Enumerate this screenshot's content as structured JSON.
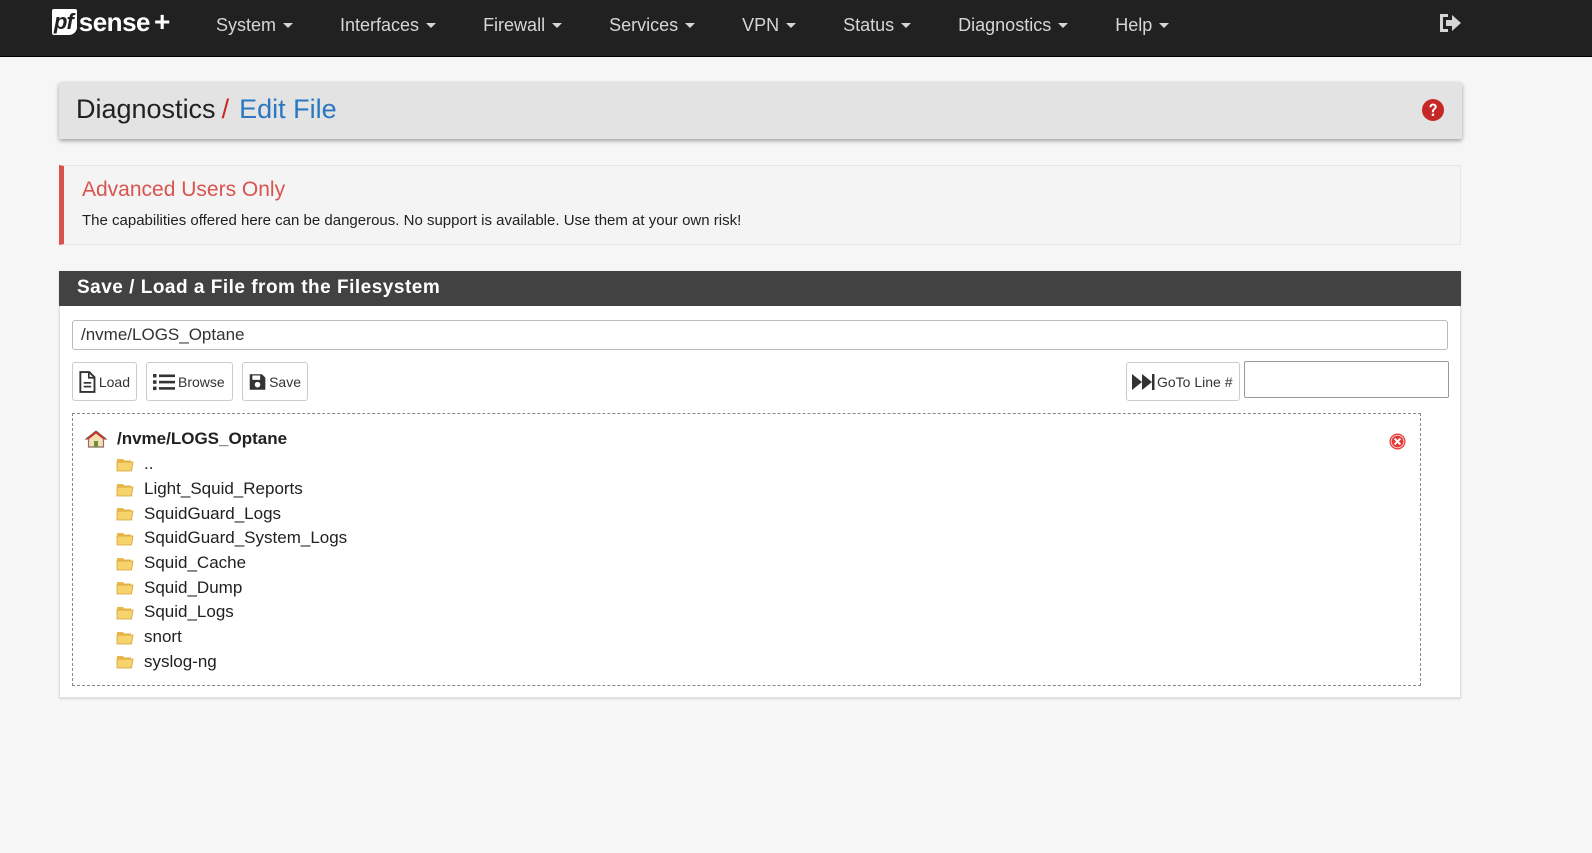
{
  "brand": {
    "pf": "pf",
    "sense": "sense",
    "plus": "+"
  },
  "nav": {
    "items": [
      {
        "label": "System",
        "name": "nav-system"
      },
      {
        "label": "Interfaces",
        "name": "nav-interfaces"
      },
      {
        "label": "Firewall",
        "name": "nav-firewall"
      },
      {
        "label": "Services",
        "name": "nav-services"
      },
      {
        "label": "VPN",
        "name": "nav-vpn"
      },
      {
        "label": "Status",
        "name": "nav-status"
      },
      {
        "label": "Diagnostics",
        "name": "nav-diagnostics"
      },
      {
        "label": "Help",
        "name": "nav-help"
      }
    ],
    "logout_icon": "sign-out-icon"
  },
  "header": {
    "breadcrumb_first": "Diagnostics",
    "separator": "/",
    "breadcrumb_current": "Edit File",
    "help_icon": "question-circle-icon"
  },
  "warning": {
    "title": "Advanced Users Only",
    "text": "The capabilities offered here can be dangerous. No support is available. Use them at your own risk!"
  },
  "panel": {
    "heading": "Save / Load a File from the Filesystem",
    "path_value": "/nvme/LOGS_Optane",
    "buttons": {
      "load": "Load",
      "browse": "Browse",
      "save": "Save",
      "goto": "GoTo Line #"
    },
    "goto_value": ""
  },
  "browser": {
    "current_path": "/nvme/LOGS_Optane",
    "items": [
      "..",
      "Light_Squid_Reports",
      "SquidGuard_Logs",
      "SquidGuard_System_Logs",
      "Squid_Cache",
      "Squid_Dump",
      "Squid_Logs",
      "snort",
      "syslog-ng"
    ]
  },
  "colors": {
    "navbar": "#212121",
    "accent_blue": "#2a78c2",
    "warning_red": "#d9534f",
    "panel_heading": "#424242"
  }
}
